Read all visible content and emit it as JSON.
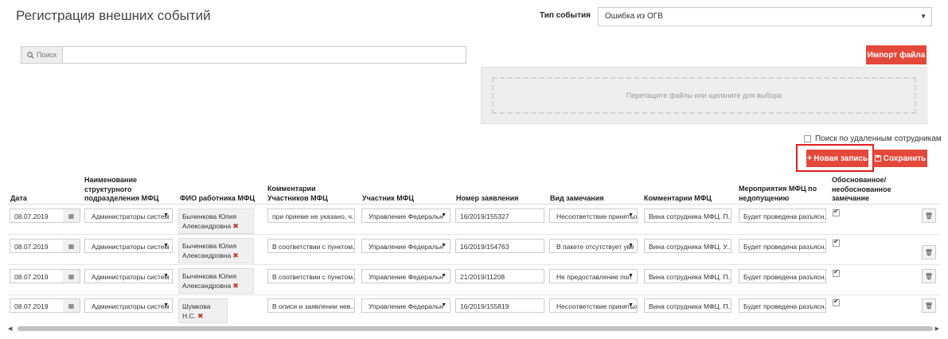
{
  "page": {
    "title": "Регистрация внешних событий",
    "event_type_label": "Тип события",
    "event_type_value": "Ошибка из ОГВ"
  },
  "search": {
    "addon_label": "Поиск",
    "value": ""
  },
  "import": {
    "button_label": "Импорт файла",
    "dropzone_text": "Перетащите файлы или щелкните для выбора"
  },
  "options": {
    "deleted_search_label": "Поиск по удаленным сотрудникам",
    "deleted_search_checked": false
  },
  "toolbar": {
    "new_label": "Новая запись",
    "save_label": "Сохранить"
  },
  "columns": {
    "date": "Дата",
    "unit": "Наименование структурного подразделения МФЦ",
    "worker": "ФИО работника МФЦ",
    "participant_comments": "Комментарии Участников МФЦ",
    "participant": "Участник МФЦ",
    "app_number": "Номер заявления",
    "remark_type": "Вид замечания",
    "mfc_comments": "Комментарии МФЦ",
    "measures": "Мероприятия МФЦ по недопущению",
    "justified": "Обоснованное/ необоснованное замечание"
  },
  "rows": [
    {
      "date": "08.07.2019",
      "unit": "Администраторы систем",
      "worker": "Быченкова Юлия Александровна",
      "participant_comment": "при приеме не указано, ч...",
      "participant": "Управление Федеральн",
      "app_number": "16/2019/155327",
      "remark_type": "Несоответствие принятых",
      "mfc_comment": "Вина сотрудника МФЦ. П...",
      "measures": "Будет проведена разъясн...",
      "justified": true
    },
    {
      "date": "08.07.2019",
      "unit": "Администраторы систем",
      "worker": "Быченкова Юлия Александровна",
      "participant_comment": "В соответствии с пунктом...",
      "participant": "Управление Федеральн",
      "app_number": "16/2019/154763",
      "remark_type": "В пакете отсутствует уве",
      "mfc_comment": "Вина сотрудника МФЦ. У...",
      "measures": "Будет проведена разъясн...",
      "justified": true
    },
    {
      "date": "08.07.2019",
      "unit": "Администраторы систем",
      "worker": "Быченкова Юлия Александровна",
      "participant_comment": "В соответствии с пунктом...",
      "participant": "Управление Федеральн",
      "app_number": "21/2019/11208",
      "remark_type": "Не предоставление пол",
      "mfc_comment": "Вина сотрудника МФЦ. П...",
      "measures": "Будет проведена разъясн...",
      "justified": true
    },
    {
      "date": "08.07.2019",
      "unit": "Администраторы систем",
      "worker": "Шумкова Н.С.",
      "participant_comment": "В описи и заявлении нев...",
      "participant": "Управление Федеральн",
      "app_number": "16/2019/155819",
      "remark_type": "Несоответствие принятых",
      "mfc_comment": "Вина сотрудника МФЦ. П...",
      "measures": "Будет проведена разъясн...",
      "justified": true
    }
  ]
}
